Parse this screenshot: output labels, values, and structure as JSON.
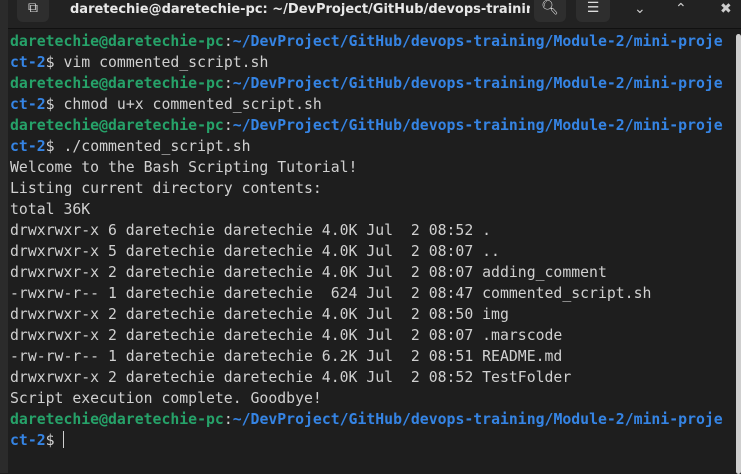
{
  "window": {
    "title": "daretechie@daretechie-pc: ~/DevProject/GitHub/devops-training...",
    "icons": [
      "new-tab-icon",
      "search-icon",
      "menu-icon",
      "minimize-icon",
      "maximize-icon",
      "close-icon"
    ]
  },
  "prompt": {
    "user": "daretechie@daretechie-pc",
    "sep": ":",
    "path1": "~/DevProject/GitHub/devops-training/Module-2/mini-proje",
    "path2": "ct-2",
    "dollar": "$ "
  },
  "commands": [
    "vim commented_script.sh",
    "chmod u+x commented_script.sh",
    "./commented_script.sh"
  ],
  "output": [
    "Welcome to the Bash Scripting Tutorial!",
    "Listing current directory contents:",
    "total 36K",
    "drwxrwxr-x 6 daretechie daretechie 4.0K Jul  2 08:52 .",
    "drwxrwxr-x 5 daretechie daretechie 4.0K Jul  2 08:07 ..",
    "drwxrwxr-x 2 daretechie daretechie 4.0K Jul  2 08:07 adding_comment",
    "-rwxrw-r-- 1 daretechie daretechie  624 Jul  2 08:47 commented_script.sh",
    "drwxrwxr-x 2 daretechie daretechie 4.0K Jul  2 08:50 img",
    "drwxrwxr-x 2 daretechie daretechie 4.0K Jul  2 08:07 .marscode",
    "-rw-rw-r-- 1 daretechie daretechie 6.2K Jul  2 08:51 README.md",
    "drwxrwxr-x 2 daretechie daretechie 4.0K Jul  2 08:52 TestFolder",
    "Script execution complete. Goodbye!"
  ]
}
